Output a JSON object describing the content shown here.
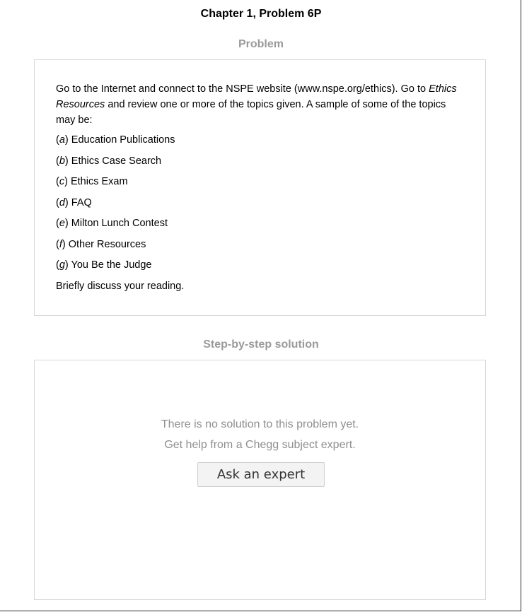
{
  "header": {
    "title": "Chapter 1, Problem 6P"
  },
  "problem": {
    "heading": "Problem",
    "intro_part1": "Go to the Internet and connect to the NSPE website (www.nspe.org/ethics). Go to ",
    "intro_italic": "Ethics Resources",
    "intro_part2": " and review one or more of the topics given. A sample of some of the topics may be:",
    "items": [
      {
        "letter": "a",
        "text": "Education Publications"
      },
      {
        "letter": "b",
        "text": "Ethics Case Search"
      },
      {
        "letter": "c",
        "text": "Ethics Exam"
      },
      {
        "letter": "d",
        "text": "FAQ"
      },
      {
        "letter": "e",
        "text": "Milton Lunch Contest"
      },
      {
        "letter": "f",
        "text": "Other Resources"
      },
      {
        "letter": "g",
        "text": "You Be the Judge"
      }
    ],
    "outro": "Briefly discuss your reading."
  },
  "solution": {
    "heading": "Step-by-step solution",
    "no_solution_line1": "There is no solution to this problem yet.",
    "no_solution_line2": "Get help from a Chegg subject expert.",
    "ask_button_label": "Ask an expert"
  }
}
